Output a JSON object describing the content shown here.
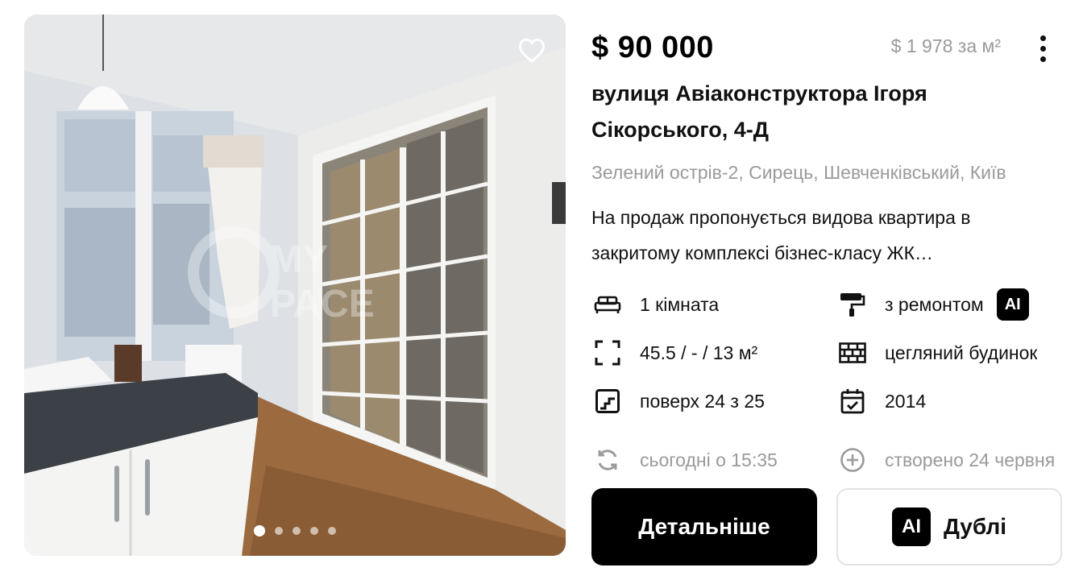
{
  "listing": {
    "price": "$ 90 000",
    "price_per_m2": "$ 1 978 за м²",
    "address": "вулиця Авіаконструктора Ігоря Сікорського, 4-Д",
    "district": "Зелений острів-2, Сирець, Шевченківський, Київ",
    "description": "На продаж пропонується видова квартира в закритому комплексі бізнес-класу ЖК…",
    "photo": {
      "watermark": "MY SPACE",
      "slide_count": 5,
      "active_slide": 1
    }
  },
  "features": {
    "rooms": "1 кімната",
    "area": "45.5 / - / 13 м²",
    "floor": "поверх 24 з 25",
    "repair": "з ремонтом",
    "repair_badge": "AI",
    "building": "цегляний будинок",
    "year": "2014",
    "updated": "сьогодні о 15:35",
    "created": "створено 24 червня"
  },
  "actions": {
    "details_label": "Детальніше",
    "duplicates_label": "Дублі",
    "duplicates_badge": "AI"
  },
  "icons": {
    "favorite": "heart-outline-icon",
    "more": "more-vertical-icon",
    "rooms": "bed-icon",
    "area": "area-frame-icon",
    "floor": "stairs-icon",
    "repair": "paint-roller-icon",
    "building": "brick-wall-icon",
    "year": "calendar-check-icon",
    "updated": "refresh-icon",
    "created": "plus-circle-icon"
  },
  "colors": {
    "accent": "#000000",
    "muted_text": "#9a9a9a",
    "button_border": "#e3e3e3"
  }
}
